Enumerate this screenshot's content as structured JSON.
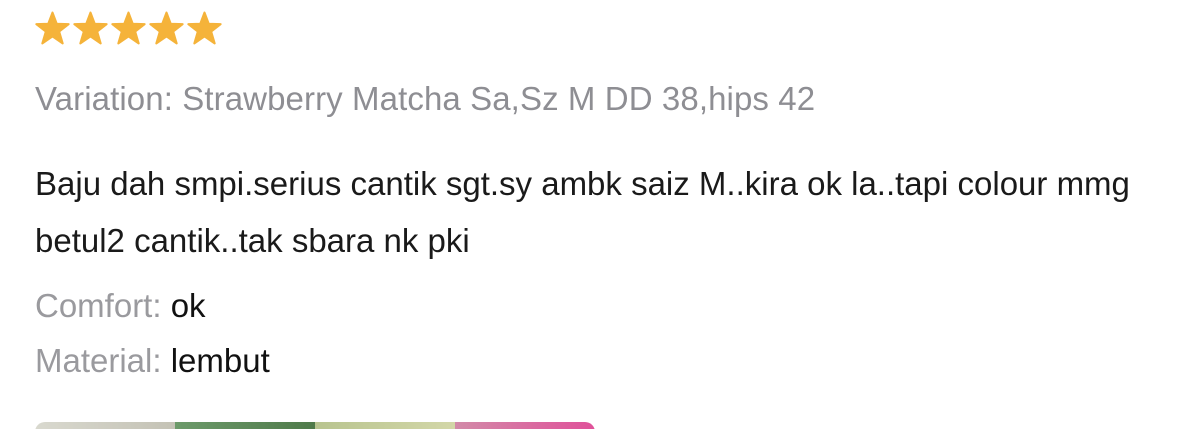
{
  "review": {
    "rating": 5,
    "max_rating": 5,
    "star_color": "#f5b33a",
    "variation": "Variation: Strawberry Matcha Sa,Sz M DD 38,hips 42",
    "comment": "Baju dah smpi.serius cantik sgt.sy ambk saiz M..kira ok la..tapi colour mmg betul2 cantik..tak sbara nk pki",
    "attributes": {
      "comfort": {
        "label": "Comfort:",
        "value": "ok"
      },
      "material": {
        "label": "Material:",
        "value": "lembut"
      }
    }
  }
}
